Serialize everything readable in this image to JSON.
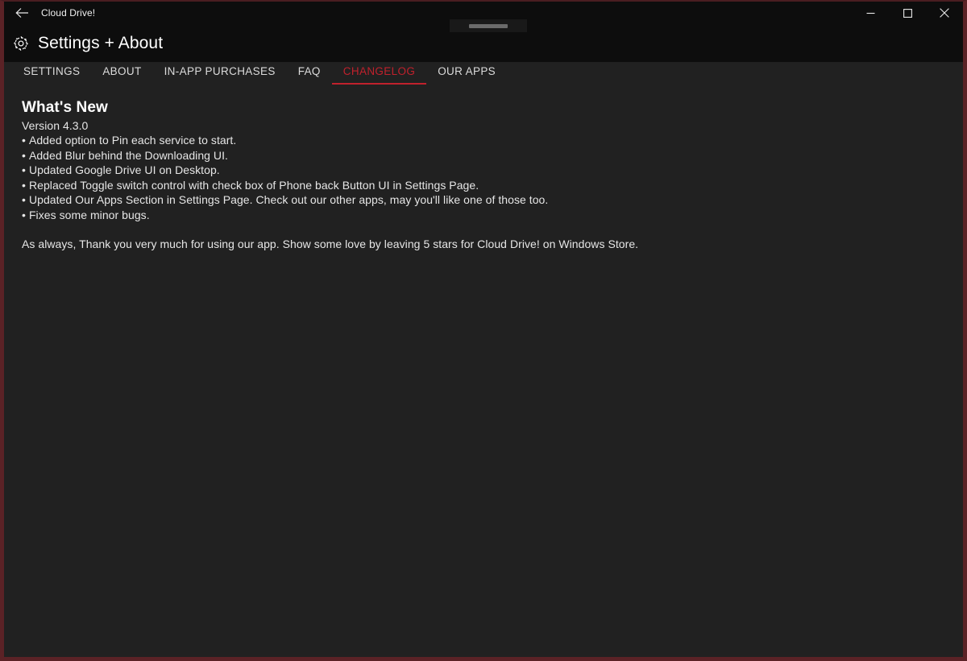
{
  "window": {
    "titlebar": {
      "back_label": "back-arrow",
      "app_title": "Cloud Drive!",
      "minimize_label": "Minimize",
      "maximize_label": "Maximize",
      "close_label": "Close"
    },
    "accent_color": "#c0212c",
    "border_color": "#5b2226",
    "background_color": "#212121",
    "header_background_color": "#0d0d0d"
  },
  "header": {
    "icon": "gear-icon",
    "title": "Settings + About"
  },
  "tabs": [
    {
      "label": "SETTINGS",
      "active": false
    },
    {
      "label": "ABOUT",
      "active": false
    },
    {
      "label": "IN-APP PURCHASES",
      "active": false
    },
    {
      "label": "FAQ",
      "active": false
    },
    {
      "label": "CHANGELOG",
      "active": true
    },
    {
      "label": "OUR APPS",
      "active": false
    }
  ],
  "content": {
    "heading": "What's New",
    "version": "Version 4.3.0",
    "bullet_char": "•",
    "items": [
      "Added option to Pin each service to start.",
      "Added Blur behind the Downloading UI.",
      "Updated Google Drive UI on Desktop.",
      "Replaced Toggle switch control with check box of Phone back Button UI in Settings Page.",
      "Updated Our Apps Section in Settings Page. Check out our other apps, may you'll like one of those too.",
      "Fixes some minor bugs."
    ],
    "closing_note": "As always, Thank you very much for using our app. Show some love by leaving 5 stars for Cloud Drive! on Windows Store."
  }
}
